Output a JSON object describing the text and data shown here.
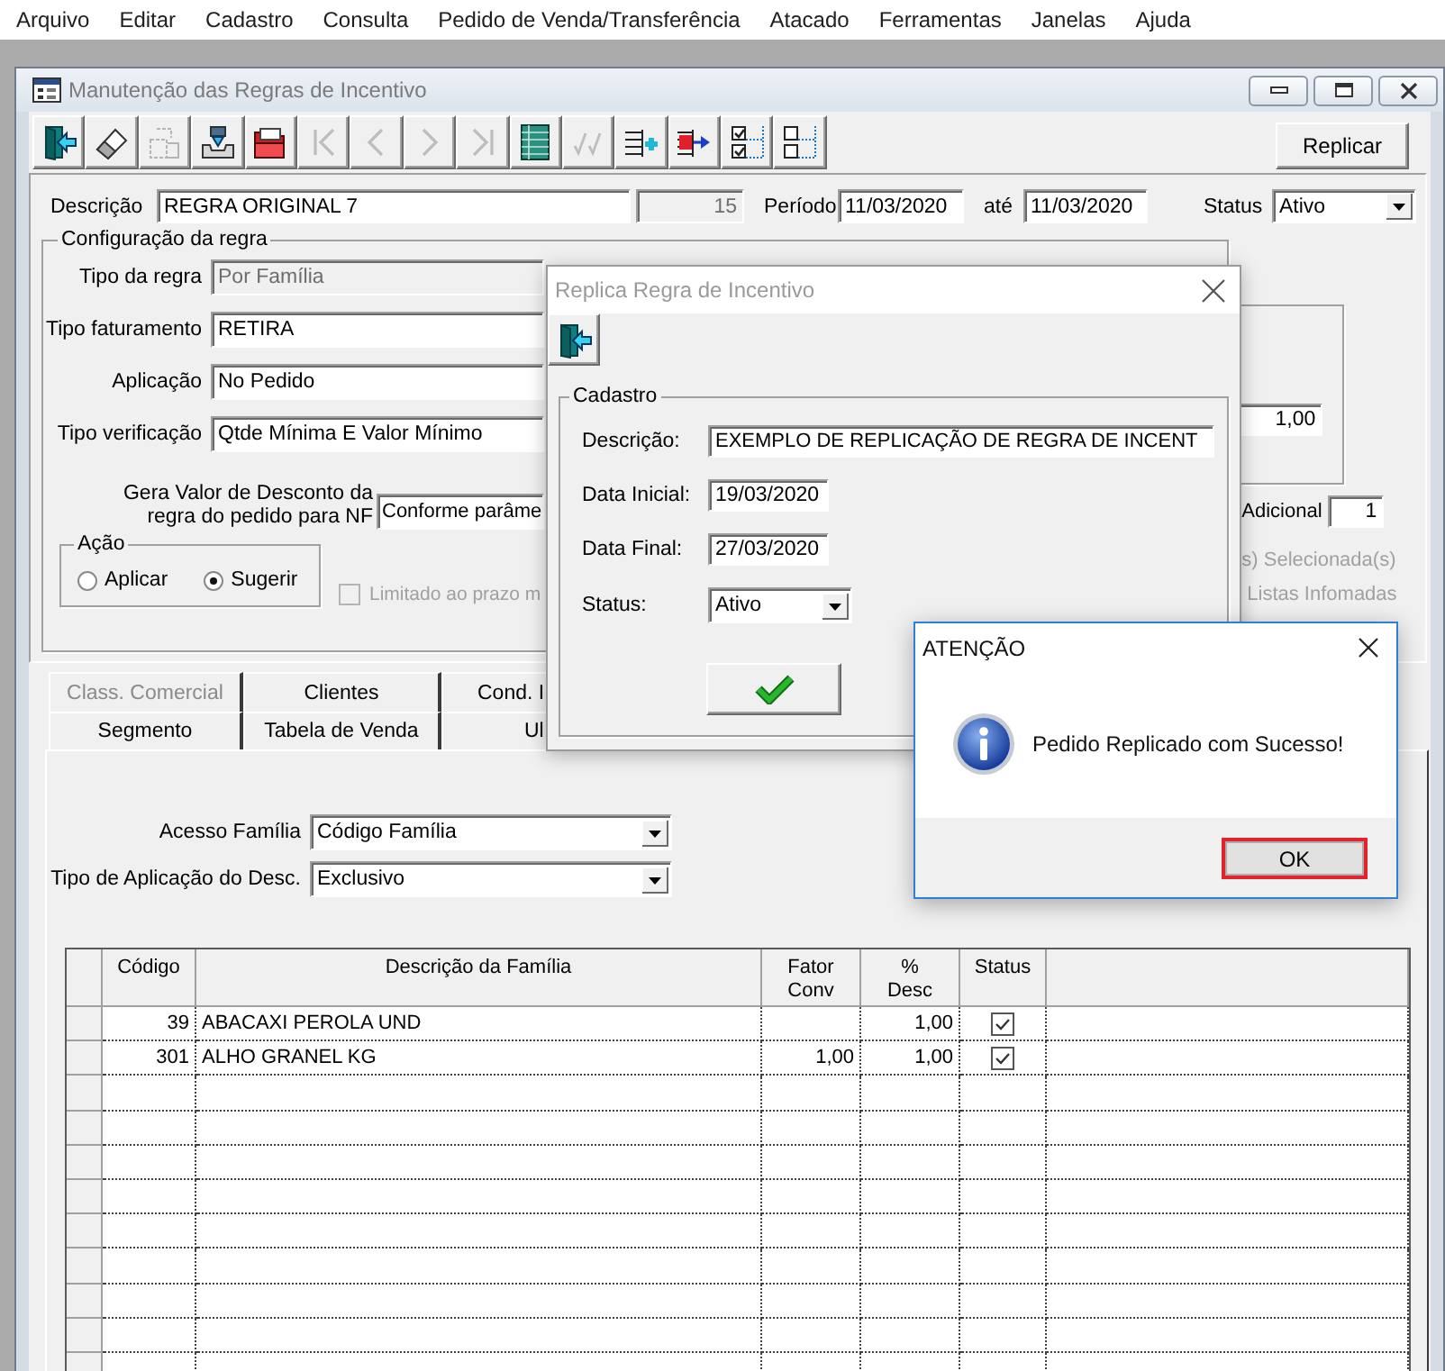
{
  "menu_bar": {
    "items": [
      "Arquivo",
      "Editar",
      "Cadastro",
      "Consulta",
      "Pedido de Venda/Transferência",
      "Atacado",
      "Ferramentas",
      "Janelas",
      "Ajuda"
    ]
  },
  "window": {
    "title": "Manutenção das Regras de Incentivo"
  },
  "toolbar": {
    "buttons": [
      {
        "kind": "exit",
        "disabled": false
      },
      {
        "kind": "erase",
        "disabled": false
      },
      {
        "kind": "copy",
        "disabled": true
      },
      {
        "kind": "import",
        "disabled": false
      },
      {
        "kind": "open",
        "disabled": false
      },
      {
        "kind": "first",
        "disabled": true
      },
      {
        "kind": "previous",
        "disabled": true
      },
      {
        "kind": "next",
        "disabled": true
      },
      {
        "kind": "last",
        "disabled": true
      },
      {
        "kind": "grid",
        "disabled": false
      },
      {
        "kind": "approve",
        "disabled": true
      },
      {
        "kind": "add_row",
        "disabled": false
      },
      {
        "kind": "move_row",
        "disabled": false
      },
      {
        "kind": "check_all",
        "disabled": false
      },
      {
        "kind": "uncheck_all",
        "disabled": false
      }
    ],
    "replicate_button": "Replicar"
  },
  "header": {
    "description": {
      "label": "Descrição",
      "value": "REGRA ORIGINAL 7"
    },
    "code": "15",
    "period": {
      "label": "Período",
      "start": "11/03/2020",
      "until_label": "até",
      "end": "11/03/2020"
    },
    "status": {
      "label": "Status",
      "value": "Ativo"
    }
  },
  "rule_config": {
    "title": "Configuração da regra",
    "fields": [
      {
        "label": "Tipo da regra",
        "value": "Por Família",
        "disabled": true
      },
      {
        "label": "Tipo faturamento",
        "value": "RETIRA",
        "disabled": false
      },
      {
        "label": "Aplicação",
        "value": "No Pedido",
        "disabled": false
      },
      {
        "label": "Tipo verificação",
        "value": "Qtde Mínima E Valor Mínimo",
        "disabled": false
      }
    ],
    "nf_discount": {
      "label": "Gera Valor de Desconto da\nregra do pedido para NF",
      "value": "Conforme parâme"
    },
    "action": {
      "title": "Ação",
      "options": [
        {
          "label": "Aplicar",
          "selected": false
        },
        {
          "label": "Sugerir",
          "selected": true
        }
      ]
    },
    "limit_checkbox": {
      "label": "Limitado ao prazo m",
      "checked": false,
      "disabled": true
    }
  },
  "side_panel": {
    "value": "1,00",
    "additional": {
      "label": "Adicional",
      "value": "1"
    },
    "options": [
      {
        "label": "s) Selecionada(s)",
        "disabled": true
      },
      {
        "label": "Listas Infomadas",
        "disabled": true
      }
    ]
  },
  "tabs": {
    "rows": [
      [
        {
          "label": "Class. Comercial",
          "selected": false,
          "disabled": true
        },
        {
          "label": "Clientes",
          "selected": false,
          "disabled": false
        },
        {
          "label": "Cond. I",
          "selected": false,
          "disabled": false
        }
      ],
      [
        {
          "label": "Segmento",
          "selected": false,
          "disabled": false
        },
        {
          "label": "Tabela de Venda",
          "selected": false,
          "disabled": false
        },
        {
          "label": "Ul",
          "selected": false,
          "disabled": false
        }
      ]
    ]
  },
  "tab_page": {
    "fields": [
      {
        "label": "Acesso Família",
        "value": "Código Família"
      },
      {
        "label": "Tipo de Aplicação do Desc.",
        "value": "Exclusivo"
      }
    ]
  },
  "table": {
    "columns": [
      "Código",
      "Descrição da Família",
      "Fator\nConv",
      "%\nDesc",
      "Status"
    ],
    "rows": [
      {
        "code": "39",
        "description": "ABACAXI PEROLA UND",
        "discount": "1,00",
        "status_checked": true
      },
      {
        "code": "301",
        "description": "ALHO GRANEL KG",
        "conversion_factor": "1,00",
        "discount": "1,00",
        "status_checked": true
      }
    ]
  },
  "replicate_dialog": {
    "title": "Replica Regra de Incentivo",
    "group_title": "Cadastro",
    "fields": [
      {
        "kind": "text",
        "label": "Descrição:",
        "value": "EXEMPLO DE REPLICAÇÃO DE REGRA DE INCENT"
      },
      {
        "kind": "date",
        "label": "Data Inicial:",
        "value": "19/03/2020"
      },
      {
        "kind": "date",
        "label": "Data Final:",
        "value": "27/03/2020"
      },
      {
        "kind": "select",
        "label": "Status:",
        "value": "Ativo"
      }
    ]
  },
  "alert_dialog": {
    "title": "ATENÇÃO",
    "message": "Pedido Replicado com Sucesso!",
    "ok_button": "OK",
    "ok_highlighted": true
  }
}
